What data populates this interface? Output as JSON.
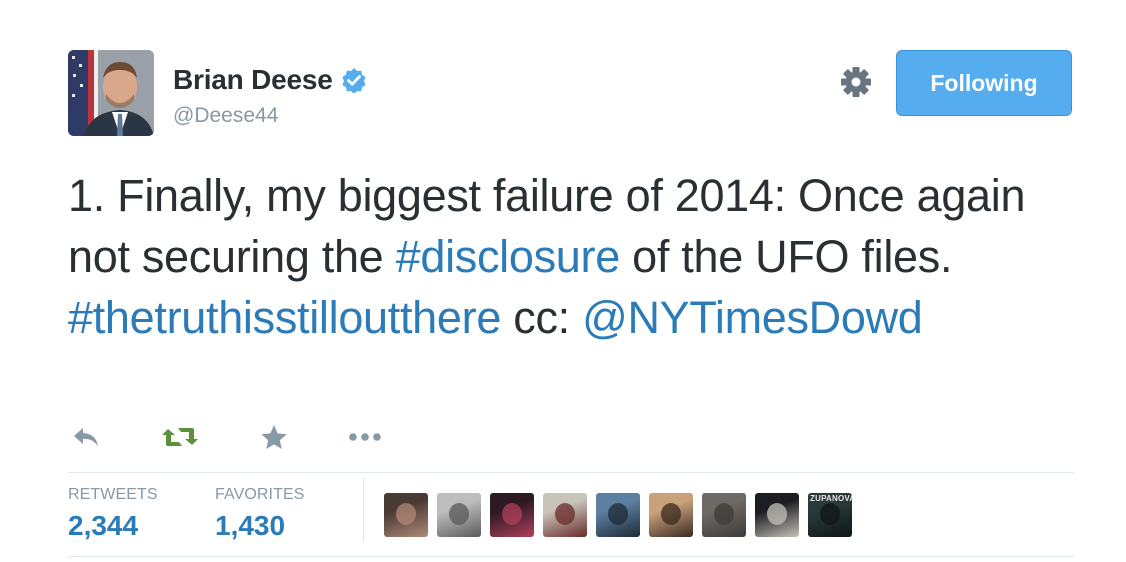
{
  "author": {
    "name": "Brian Deese",
    "handle": "@Deese44",
    "verified": true
  },
  "follow_button": {
    "label": "Following"
  },
  "tweet": {
    "segments": [
      {
        "type": "text",
        "text": "1. Finally, my biggest failure of 2014: Once again not securing the "
      },
      {
        "type": "hashtag",
        "text": "#disclosure"
      },
      {
        "type": "text",
        "text": " of the UFO files. "
      },
      {
        "type": "hashtag",
        "text": "#thetruthisstilloutthere"
      },
      {
        "type": "text",
        "text": " cc: "
      },
      {
        "type": "mention",
        "text": "@NYTimesDowd"
      }
    ]
  },
  "actions": [
    {
      "name": "reply-icon",
      "color": "#8899a6"
    },
    {
      "name": "retweet-icon",
      "color": "#5c913b"
    },
    {
      "name": "favorite-icon",
      "color": "#8899a6"
    },
    {
      "name": "more-icon",
      "color": "#8899a6"
    }
  ],
  "stats": {
    "retweets": {
      "label": "RETWEETS",
      "count": "2,344"
    },
    "favorites": {
      "label": "FAVORITES",
      "count": "1,430"
    }
  },
  "favoriters": [
    {
      "name": "favoriter-avatar-1",
      "colors": [
        "#4a3a35",
        "#b08a78"
      ],
      "label": ""
    },
    {
      "name": "favoriter-avatar-2",
      "colors": [
        "#bdbdbd",
        "#5a5a5a"
      ],
      "label": ""
    },
    {
      "name": "favoriter-avatar-3",
      "colors": [
        "#2b1a22",
        "#b0405a"
      ],
      "label": ""
    },
    {
      "name": "favoriter-avatar-4",
      "colors": [
        "#c8c4b8",
        "#6a2a2a"
      ],
      "label": ""
    },
    {
      "name": "favoriter-avatar-5",
      "colors": [
        "#5d7fa0",
        "#1e2a36"
      ],
      "label": ""
    },
    {
      "name": "favoriter-avatar-6",
      "colors": [
        "#c9a27a",
        "#3a2a22"
      ],
      "label": ""
    },
    {
      "name": "favoriter-avatar-7",
      "colors": [
        "#6d6a66",
        "#3d3b38"
      ],
      "label": ""
    },
    {
      "name": "favoriter-avatar-8",
      "colors": [
        "#1d1d24",
        "#c7c2b8"
      ],
      "label": ""
    },
    {
      "name": "favoriter-avatar-9",
      "colors": [
        "#2a3a3a",
        "#0f1515"
      ],
      "label": "ZUPANOVA"
    }
  ],
  "colors": {
    "link": "#2b7bb9",
    "follow_button": "#55acee",
    "retweeted": "#5c913b",
    "muted": "#8899a6",
    "verified": "#55acee"
  }
}
